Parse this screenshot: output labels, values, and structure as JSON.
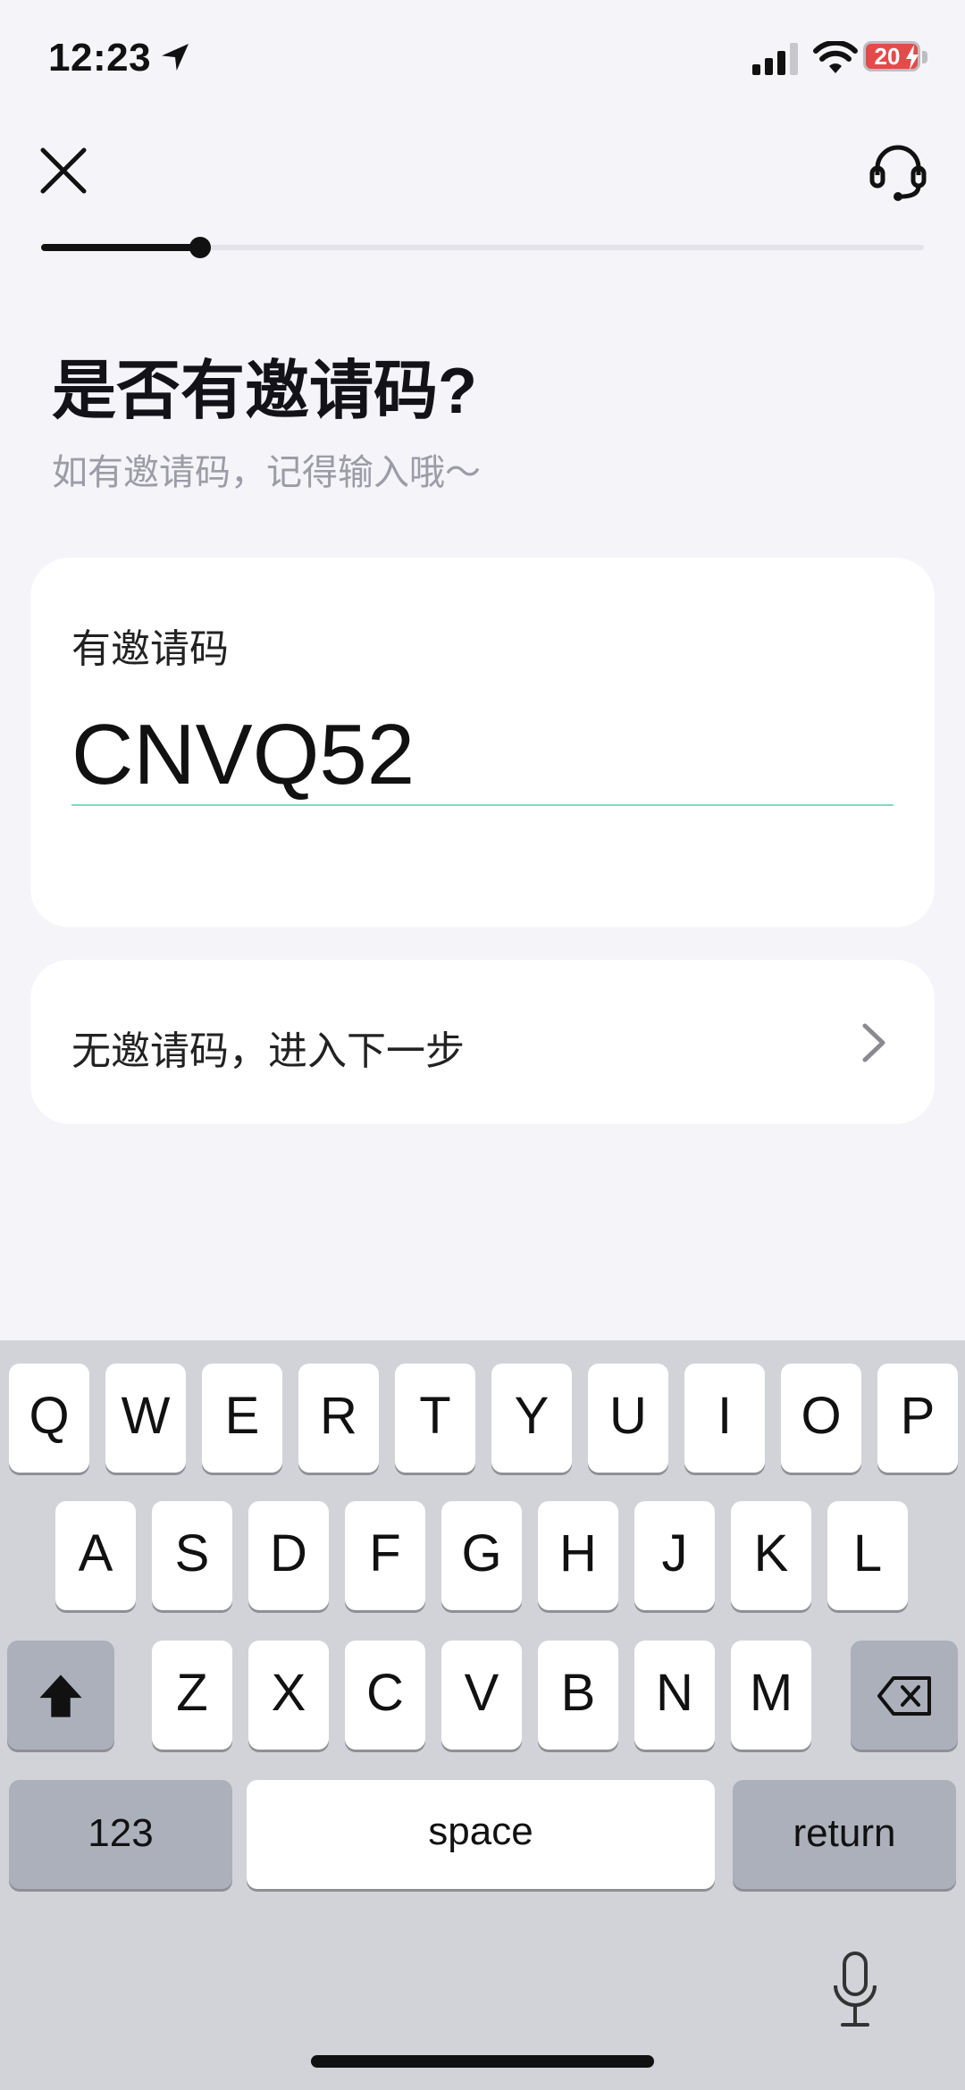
{
  "status_bar": {
    "time": "12:23",
    "battery": "20",
    "battery_color": "#e34b4b"
  },
  "header": {
    "close_icon": "close-icon",
    "support_icon": "headset-icon"
  },
  "progress": {
    "fraction": 0.18
  },
  "title": "是否有邀请码?",
  "subtitle": "如有邀请码，记得输入哦～",
  "invite_card": {
    "label": "有邀请码",
    "value": "CNVQ52",
    "underline_color": "#7fdcc0"
  },
  "skip_card": {
    "label": "无邀请码，进入下一步",
    "chevron_icon": "chevron-right-icon"
  },
  "keyboard": {
    "row1": [
      "Q",
      "W",
      "E",
      "R",
      "T",
      "Y",
      "U",
      "I",
      "O",
      "P"
    ],
    "row2": [
      "A",
      "S",
      "D",
      "F",
      "G",
      "H",
      "J",
      "K",
      "L"
    ],
    "row3": [
      "Z",
      "X",
      "C",
      "V",
      "B",
      "N",
      "M"
    ],
    "numbers_label": "123",
    "space_label": "space",
    "return_label": "return",
    "shift_icon": "shift-icon",
    "delete_icon": "backspace-icon",
    "mic_icon": "microphone-icon"
  }
}
